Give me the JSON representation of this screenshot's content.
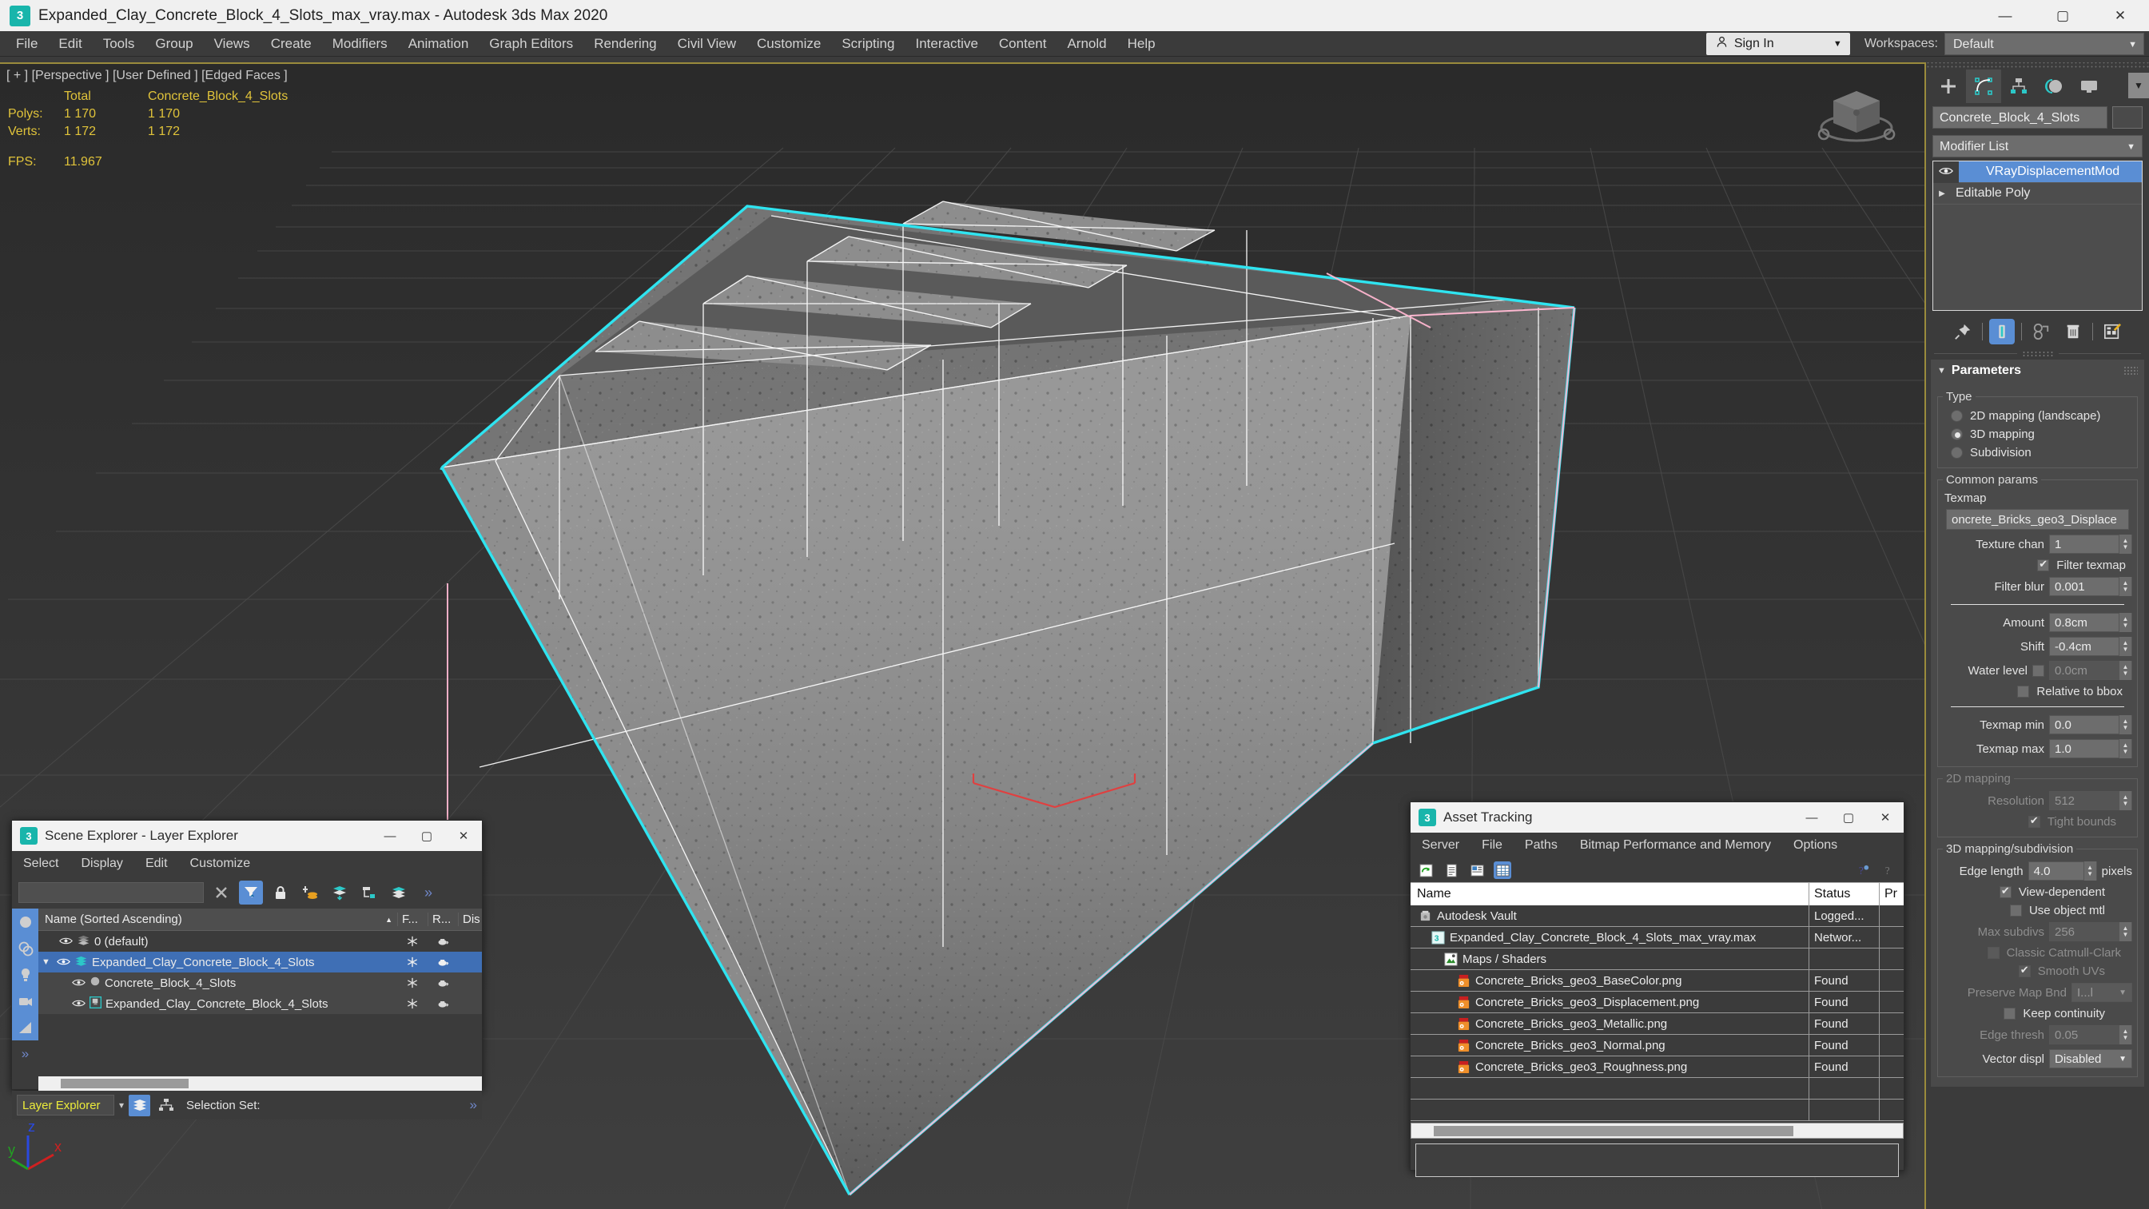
{
  "window": {
    "title": "Expanded_Clay_Concrete_Block_4_Slots_max_vray.max - Autodesk 3ds Max 2020",
    "app_badge": "3",
    "minimize": "—",
    "maximize": "▢",
    "close": "✕"
  },
  "menubar": {
    "items": [
      {
        "label": "File"
      },
      {
        "label": "Edit"
      },
      {
        "label": "Tools"
      },
      {
        "label": "Group"
      },
      {
        "label": "Views"
      },
      {
        "label": "Create"
      },
      {
        "label": "Modifiers"
      },
      {
        "label": "Animation"
      },
      {
        "label": "Graph Editors"
      },
      {
        "label": "Rendering"
      },
      {
        "label": "Civil View"
      },
      {
        "label": "Customize"
      },
      {
        "label": "Scripting"
      },
      {
        "label": "Interactive"
      },
      {
        "label": "Content"
      },
      {
        "label": "Arnold"
      },
      {
        "label": "Help"
      }
    ],
    "sign_in": "Sign In",
    "sign_in_icon": "person-icon",
    "caret": "▼",
    "workspaces_label": "Workspaces:",
    "workspace_value": "Default"
  },
  "viewport": {
    "label": "[ + ] [Perspective ] [User Defined ] [Edged Faces ]",
    "stats": {
      "col_total": "Total",
      "col_object": "Concrete_Block_4_Slots",
      "rows": [
        {
          "name": "Polys:",
          "total": "1 170",
          "object": "1 170"
        },
        {
          "name": "Verts:",
          "total": "1 172",
          "object": "1 172"
        }
      ],
      "fps_label": "FPS:",
      "fps_value": "11.967"
    },
    "axis": {
      "x": "x",
      "y": "y",
      "z": "z"
    },
    "selection_color": "#2fe4f0",
    "wire_color": "#ffb6d0"
  },
  "command_panel": {
    "tabs": [
      {
        "name": "create-tab",
        "icon": "plus-icon",
        "active": false
      },
      {
        "name": "modify-tab",
        "icon": "modify-icon",
        "active": true
      },
      {
        "name": "hierarchy-tab",
        "icon": "hierarchy-icon",
        "active": false
      },
      {
        "name": "motion-tab",
        "icon": "motion-icon",
        "active": false
      },
      {
        "name": "display-tab",
        "icon": "display-icon",
        "active": false
      }
    ],
    "more_caret": "▼",
    "object_name": "Concrete_Block_4_Slots",
    "modifier_list_label": "Modifier List",
    "modifier_list_caret": "▼",
    "stack": [
      {
        "label": "VRayDisplacementMod",
        "selected": true,
        "eye": "👁"
      },
      {
        "label": "Editable Poly",
        "selected": false,
        "arrow": "▶"
      }
    ],
    "stack_buttons": [
      {
        "name": "pin-stack-icon",
        "active": false
      },
      {
        "name": "show-end-result-icon",
        "active": true
      },
      {
        "name": "make-unique-icon",
        "active": false
      },
      {
        "name": "remove-modifier-icon",
        "active": false
      },
      {
        "name": "configure-modifier-sets-icon",
        "active": false
      }
    ],
    "rollout": {
      "title": "Parameters",
      "triangle": "▼",
      "type_group": "Type",
      "type_options": [
        {
          "label": "2D mapping (landscape)",
          "selected": false
        },
        {
          "label": "3D mapping",
          "selected": true
        },
        {
          "label": "Subdivision",
          "selected": false
        }
      ],
      "common_group": "Common params",
      "texmap_label": "Texmap",
      "texmap_value": "oncrete_Bricks_geo3_Displace",
      "texture_chan_label": "Texture chan",
      "texture_chan_value": "1",
      "filter_texmap_label": "Filter texmap",
      "filter_texmap_checked": true,
      "filter_blur_label": "Filter blur",
      "filter_blur_value": "0.001",
      "amount_label": "Amount",
      "amount_value": "0.8cm",
      "shift_label": "Shift",
      "shift_value": "-0.4cm",
      "water_level_label": "Water level",
      "water_level_value": "0.0cm",
      "water_level_checked": false,
      "relative_bbox_label": "Relative to bbox",
      "relative_bbox_checked": false,
      "texmap_min_label": "Texmap min",
      "texmap_min_value": "0.0",
      "texmap_max_label": "Texmap max",
      "texmap_max_value": "1.0",
      "mapping2d_group": "2D mapping",
      "resolution_label": "Resolution",
      "resolution_value": "512",
      "tight_bounds_label": "Tight bounds",
      "tight_bounds_checked": true,
      "mapping3d_group": "3D mapping/subdivision",
      "edge_length_label": "Edge length",
      "edge_length_value": "4.0",
      "edge_length_unit": "pixels",
      "view_dependent_label": "View-dependent",
      "view_dependent_checked": true,
      "use_object_mtl_label": "Use object mtl",
      "use_object_mtl_checked": false,
      "max_subdivs_label": "Max subdivs",
      "max_subdivs_value": "256",
      "classic_cc_label": "Classic Catmull-Clark",
      "classic_cc_checked": false,
      "smooth_uvs_label": "Smooth UVs",
      "smooth_uvs_checked": true,
      "preserve_map_label": "Preserve Map Bnd",
      "preserve_map_value": "I...l",
      "keep_continuity_label": "Keep continuity",
      "keep_continuity_checked": false,
      "edge_thresh_label": "Edge thresh",
      "edge_thresh_value": "0.05",
      "vector_displ_label": "Vector displ",
      "vector_displ_value": "Disabled"
    }
  },
  "scene_explorer": {
    "title": "Scene Explorer - Layer Explorer",
    "app_badge": "3",
    "minimize": "—",
    "maximize": "▢",
    "close": "✕",
    "menu": [
      {
        "label": "Select"
      },
      {
        "label": "Display"
      },
      {
        "label": "Edit"
      },
      {
        "label": "Customize"
      }
    ],
    "search_value": "",
    "toolbar": [
      {
        "name": "clear-search-icon",
        "glyph": "✕",
        "active": false
      },
      {
        "name": "filter-selection-icon",
        "glyph": "",
        "active": true
      },
      {
        "name": "lock-icon",
        "glyph": "",
        "active": false
      },
      {
        "name": "add-layer-icon",
        "glyph": "",
        "active": false
      },
      {
        "name": "add-selection-to-layer-icon",
        "glyph": "",
        "active": false
      },
      {
        "name": "select-layer-objects-icon",
        "glyph": "",
        "active": false
      },
      {
        "name": "layers-icon",
        "glyph": "",
        "active": false
      },
      {
        "name": "overflow-icon",
        "glyph": "»",
        "active": false
      }
    ],
    "leftbar": [
      {
        "name": "filter-geometry-icon",
        "active": true
      },
      {
        "name": "filter-shapes-icon",
        "active": true
      },
      {
        "name": "filter-lights-icon",
        "active": true
      },
      {
        "name": "filter-cameras-icon",
        "active": true
      },
      {
        "name": "filter-helpers-icon",
        "active": true
      },
      {
        "name": "filter-overflow-icon",
        "active": false
      }
    ],
    "columns": {
      "name": "Name (Sorted Ascending)",
      "sort_arrow": "▲",
      "frozen": "F...",
      "render": "R...",
      "display": "Dis"
    },
    "rows": [
      {
        "label": "0 (default)",
        "indent": 1,
        "icon": "layer-icon",
        "selected": false,
        "expander": "",
        "eye": "👁"
      },
      {
        "label": "Expanded_Clay_Concrete_Block_4_Slots",
        "indent": 1,
        "icon": "layer-active-icon",
        "selected": true,
        "expander": "▼",
        "eye": "👁"
      },
      {
        "label": "Concrete_Block_4_Slots",
        "indent": 2,
        "icon": "object-icon",
        "selected": false,
        "expander": "",
        "eye": "👁"
      },
      {
        "label": "Expanded_Clay_Concrete_Block_4_Slots",
        "indent": 2,
        "icon": "xref-icon",
        "selected": false,
        "expander": "",
        "eye": "👁"
      }
    ],
    "footer": {
      "mode": "Layer Explorer",
      "caret": "▾",
      "selection_set_label": "Selection Set:",
      "overflow": "»"
    }
  },
  "asset_tracking": {
    "title": "Asset Tracking",
    "app_badge": "3",
    "minimize": "—",
    "maximize": "▢",
    "close": "✕",
    "menu": [
      {
        "label": "Server"
      },
      {
        "label": "File"
      },
      {
        "label": "Paths"
      },
      {
        "label": "Bitmap Performance and Memory"
      },
      {
        "label": "Options"
      }
    ],
    "toolbar": [
      {
        "name": "refresh-icon",
        "active": false
      },
      {
        "name": "list-view-icon",
        "active": false
      },
      {
        "name": "detail-view-icon",
        "active": false
      },
      {
        "name": "grid-view-icon",
        "active": true
      },
      {
        "name": "help-new-icon",
        "active": false
      },
      {
        "name": "help-icon",
        "active": false
      }
    ],
    "columns": {
      "name": "Name",
      "status": "Status",
      "path": "Pr"
    },
    "rows": [
      {
        "label": "Autodesk Vault",
        "status": "Logged...",
        "indent": 1,
        "icon": "vault-icon"
      },
      {
        "label": "Expanded_Clay_Concrete_Block_4_Slots_max_vray.max",
        "status": "Networ...",
        "indent": 2,
        "icon": "max-file-icon"
      },
      {
        "label": "Maps / Shaders",
        "status": "",
        "indent": 3,
        "icon": "maps-icon"
      },
      {
        "label": "Concrete_Bricks_geo3_BaseColor.png",
        "status": "Found",
        "indent": 4,
        "icon": "png-icon"
      },
      {
        "label": "Concrete_Bricks_geo3_Displacement.png",
        "status": "Found",
        "indent": 4,
        "icon": "png-icon"
      },
      {
        "label": "Concrete_Bricks_geo3_Metallic.png",
        "status": "Found",
        "indent": 4,
        "icon": "png-icon"
      },
      {
        "label": "Concrete_Bricks_geo3_Normal.png",
        "status": "Found",
        "indent": 4,
        "icon": "png-icon"
      },
      {
        "label": "Concrete_Bricks_geo3_Roughness.png",
        "status": "Found",
        "indent": 4,
        "icon": "png-icon"
      },
      {
        "label": "",
        "status": "",
        "indent": 1,
        "icon": ""
      },
      {
        "label": "",
        "status": "",
        "indent": 1,
        "icon": ""
      }
    ]
  }
}
